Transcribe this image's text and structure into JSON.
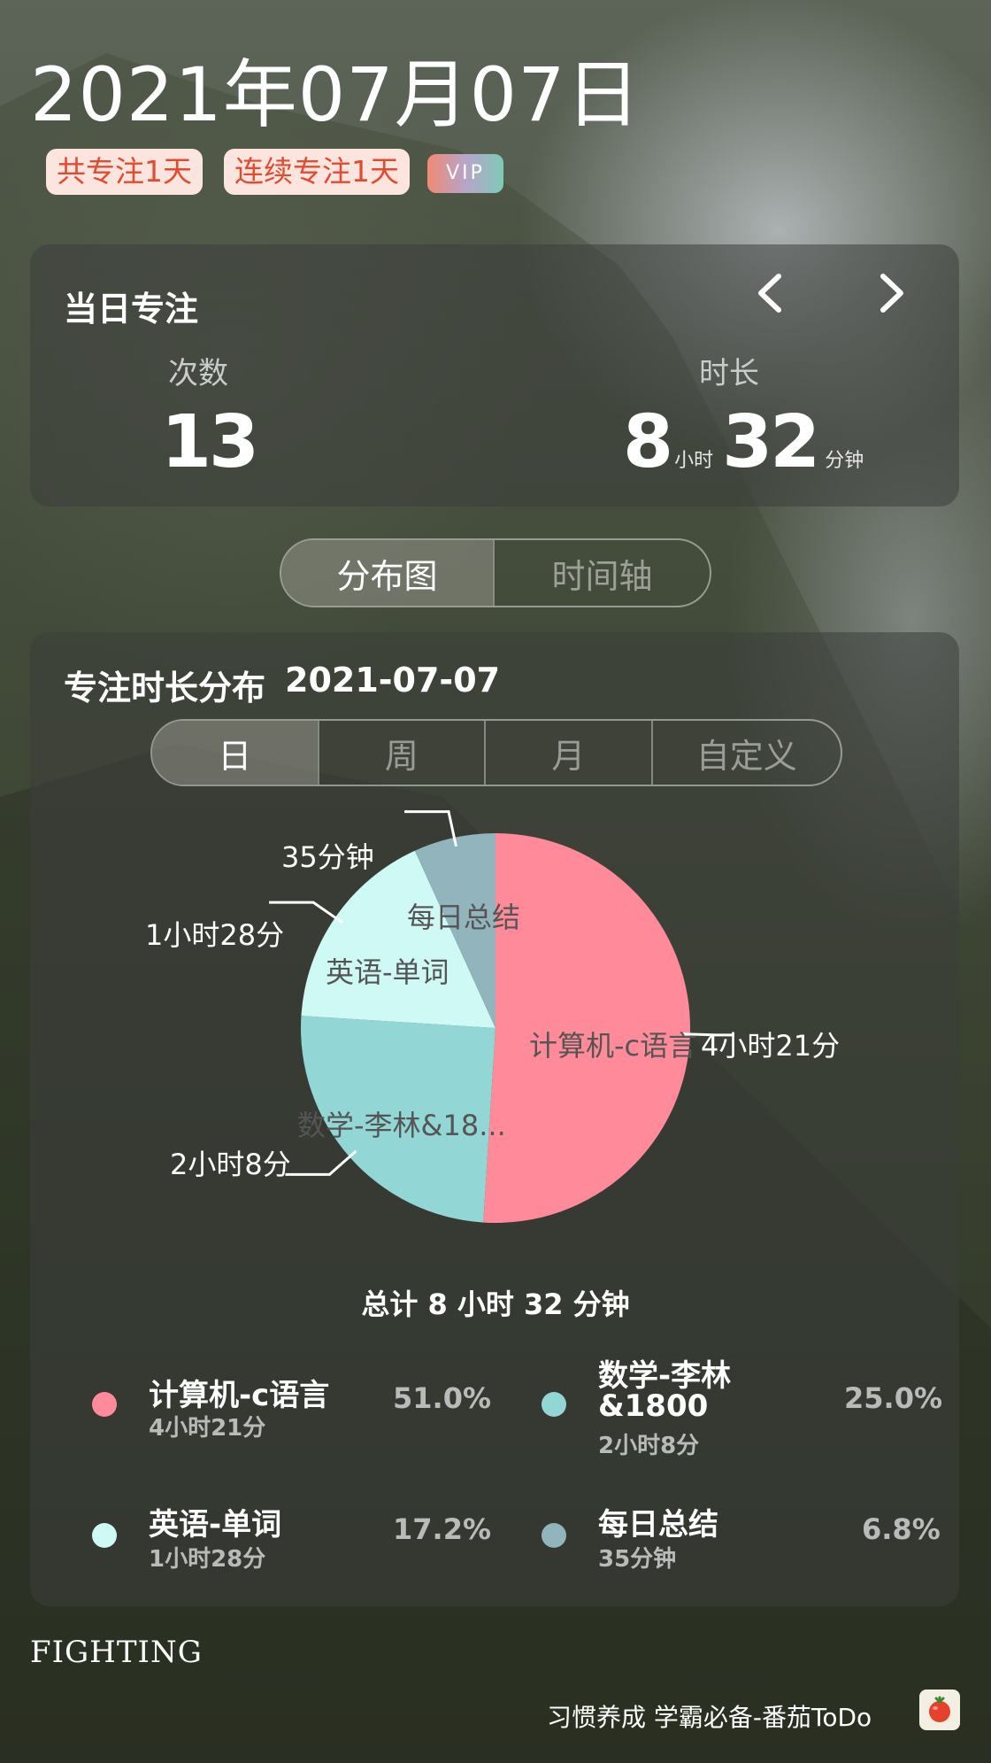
{
  "header": {
    "date": "2021年07月07日",
    "badges": [
      "共专注1天",
      "连续专注1天"
    ],
    "vip": "VIP"
  },
  "daily": {
    "title": "当日专注",
    "count_label": "次数",
    "count": "13",
    "duration_label": "时长",
    "hours": "8",
    "hours_unit": "小时",
    "minutes": "32",
    "minutes_unit": "分钟",
    "prev_icon": "chevron-left-icon",
    "next_icon": "chevron-right-icon"
  },
  "view_tabs": [
    "分布图",
    "时间轴"
  ],
  "distribution": {
    "title": "专注时长分布",
    "date": "2021-07-07",
    "period_tabs": [
      "日",
      "周",
      "月",
      "自定义"
    ],
    "total": "总计 8 小时 32 分钟"
  },
  "chart_data": {
    "type": "pie",
    "slices": [
      {
        "name": "计算机-c语言",
        "short": "计算机-c语言",
        "duration": "4小时21分",
        "percent": 51.0,
        "color": "#ff8a99"
      },
      {
        "name": "数学-李林&1800",
        "short": "数学-李林&18...",
        "duration": "2小时8分",
        "percent": 25.0,
        "color": "#93d6d6"
      },
      {
        "name": "英语-单词",
        "short": "英语-单词",
        "duration": "1小时28分",
        "percent": 17.2,
        "color": "#cff9f5"
      },
      {
        "name": "每日总结",
        "short": "每日总结",
        "duration": "35分钟",
        "percent": 6.8,
        "color": "#92b4bc"
      }
    ]
  },
  "legend": [
    {
      "name": "计算机-c语言",
      "sub": "4小时21分",
      "pct": "51.0%",
      "color": "#ff8a99"
    },
    {
      "name_line1": "数学-李林",
      "name_line2": "&1800",
      "sub": "2小时8分",
      "pct": "25.0%",
      "color": "#93d6d6"
    },
    {
      "name": "英语-单词",
      "sub": "1小时28分",
      "pct": "17.2%",
      "color": "#cff9f5"
    },
    {
      "name": "每日总结",
      "sub": "35分钟",
      "pct": "6.8%",
      "color": "#92b4bc"
    }
  ],
  "footer": {
    "motto": "FIGHTING",
    "slogan": "习惯养成 学霸必备-番茄ToDo",
    "app_icon": "tomato-icon"
  }
}
